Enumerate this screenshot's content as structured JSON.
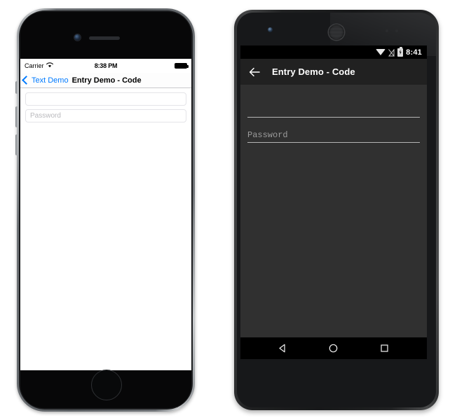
{
  "ios": {
    "device_name": "iPhone",
    "status_bar": {
      "carrier": "Carrier",
      "wifi_icon": "wifi-icon",
      "time": "8:38 PM",
      "battery_icon": "battery-full-icon"
    },
    "nav_bar": {
      "back_chevron_icon": "chevron-left-icon",
      "back_label": "Text Demo",
      "title": "Entry Demo - Code",
      "tint_color": "#007AFF"
    },
    "form": {
      "fields": [
        {
          "placeholder": "",
          "value": ""
        },
        {
          "placeholder": "Password",
          "value": ""
        }
      ]
    },
    "home_button_icon": "home-button"
  },
  "android": {
    "device_name": "Android",
    "status_bar": {
      "wifi_icon": "wifi-icon",
      "signal_icon": "signal-no-sim-icon",
      "battery_icon": "battery-charging-icon",
      "time": "8:41"
    },
    "toolbar": {
      "back_icon": "arrow-left-icon",
      "title": "Entry Demo - Code",
      "background": "#212121"
    },
    "form": {
      "fields": [
        {
          "placeholder": "",
          "value": ""
        },
        {
          "placeholder": "Password",
          "value": ""
        }
      ]
    },
    "nav_bar": {
      "back_icon": "triangle-back-icon",
      "home_icon": "circle-home-icon",
      "recents_icon": "square-recents-icon"
    },
    "content_background": "#303030"
  }
}
